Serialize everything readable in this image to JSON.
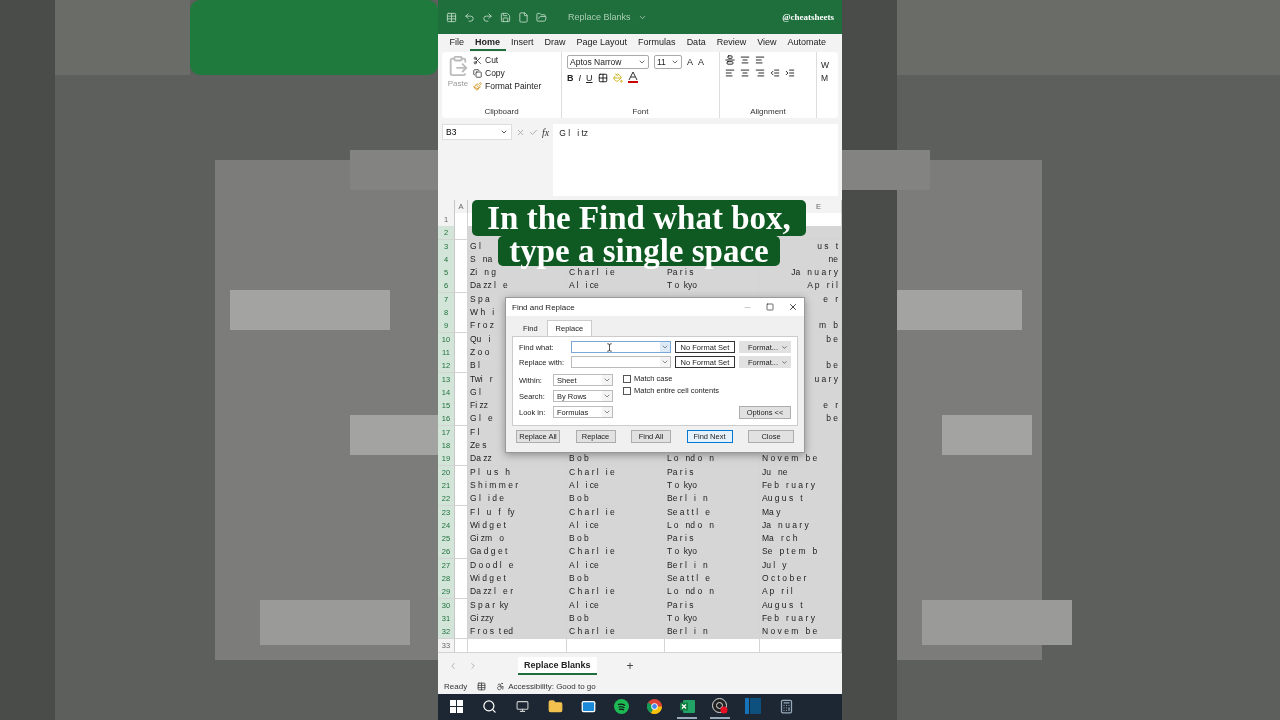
{
  "title_bar": {
    "file_name": "Replace Blanks",
    "handle": "@cheatsheets"
  },
  "ribbon_tabs": [
    {
      "label": "File",
      "selected": false
    },
    {
      "label": "Home",
      "selected": true
    },
    {
      "label": "Insert",
      "selected": false
    },
    {
      "label": "Draw",
      "selected": false
    },
    {
      "label": "Page Layout",
      "selected": false
    },
    {
      "label": "Formulas",
      "selected": false
    },
    {
      "label": "Data",
      "selected": false
    },
    {
      "label": "Review",
      "selected": false
    },
    {
      "label": "View",
      "selected": false
    },
    {
      "label": "Automate",
      "selected": false
    }
  ],
  "ribbon": {
    "clipboard": {
      "paste": "Paste",
      "cut": "Cut",
      "copy": "Copy",
      "format_painter": "Format Painter",
      "label": "Clipboard"
    },
    "font": {
      "name": "Aptos Narrow",
      "size": "11",
      "grow": "A",
      "shrink": "A",
      "bold": "B",
      "italic": "I",
      "underline": "U",
      "label": "Font"
    },
    "alignment": {
      "label": "Alignment"
    },
    "wrap_text": "W",
    "merge": "M"
  },
  "formula_bar": {
    "cell": "B3",
    "fx": "fx",
    "content": "G l   i tz"
  },
  "column_headers": [
    "A",
    "E"
  ],
  "rows": [
    {
      "number": "1",
      "selected": false
    },
    {
      "number": "2",
      "selected": true
    },
    {
      "number": "3",
      "selected": true,
      "b": "G l",
      "e": "u s   t"
    },
    {
      "number": "4",
      "selected": true,
      "b": "S   na",
      "e": "ne"
    },
    {
      "number": "5",
      "selected": true,
      "b": "Zi   n g",
      "c": "C h a r l   i e",
      "d": "Pa r i s",
      "e": "Ja   n u a r y"
    },
    {
      "number": "6",
      "selected": true,
      "b": "Da zz l   e",
      "c": "A l   i ce",
      "d": "T o  kyo",
      "e": "A p   r i l"
    },
    {
      "number": "7",
      "selected": true,
      "b": "S p a",
      "e": "e   r"
    },
    {
      "number": "8",
      "selected": true,
      "b": "W h   i"
    },
    {
      "number": "9",
      "selected": true,
      "b": "F r o z",
      "e": "m   b"
    },
    {
      "number": "10",
      "selected": true,
      "b": "Qu   i",
      "e": "b e"
    },
    {
      "number": "11",
      "selected": true,
      "b": "Z o o"
    },
    {
      "number": "12",
      "selected": true,
      "b": "B l",
      "e": "b e"
    },
    {
      "number": "13",
      "selected": true,
      "b": "Twi   r",
      "e": "u a r y"
    },
    {
      "number": "14",
      "selected": true,
      "b": "G l"
    },
    {
      "number": "15",
      "selected": true,
      "b": "Fi zz",
      "e": "e   r"
    },
    {
      "number": "16",
      "selected": true,
      "b": "G l   e",
      "e": "b e"
    },
    {
      "number": "17",
      "selected": true,
      "b": "F l"
    },
    {
      "number": "18",
      "selected": true,
      "b": "Ze s"
    },
    {
      "number": "19",
      "selected": true,
      "b": "Da zz",
      "c": "B o b",
      "d": "L o   nd o   n",
      "e": "N o v e m   b e"
    },
    {
      "number": "20",
      "selected": true,
      "b": "P l   u s   h",
      "c": "C h a r l   i e",
      "d": "Pa r i s",
      "e": "Ju   ne"
    },
    {
      "number": "21",
      "selected": true,
      "b": "S h i m m e r",
      "c": "A l   i ce",
      "d": "T o  kyo",
      "e": "Fe b   r u a r y"
    },
    {
      "number": "22",
      "selected": true,
      "b": "G l   i d e",
      "c": "B o b",
      "d": "Be r l   i   n",
      "e": "Au g u s   t"
    },
    {
      "number": "23",
      "selected": true,
      "b": "F l   u   f   fy",
      "c": "C h a r l   i e",
      "d": "Se a t t l   e",
      "e": "Ma y"
    },
    {
      "number": "24",
      "selected": true,
      "b": "Wi d g e t",
      "c": "A l   i ce",
      "d": "L o   nd o   n",
      "e": "Ja   n u a r y"
    },
    {
      "number": "25",
      "selected": true,
      "b": "Gi zm   o",
      "c": "B o b",
      "d": "Pa r i s",
      "e": "Ma   r c h"
    },
    {
      "number": "26",
      "selected": true,
      "b": "Ga d g e t",
      "c": "C h a r l   i e",
      "d": "T o  kyo",
      "e": "Se   p t e m   b"
    },
    {
      "number": "27",
      "selected": true,
      "b": "D o o d l   e",
      "c": "A l   i ce",
      "d": "Be r l   i   n",
      "e": "Ju l   y"
    },
    {
      "number": "28",
      "selected": true,
      "b": "Wi d g e t",
      "c": "B o b",
      "d": "Se a t t l   e",
      "e": "O c t o b e r"
    },
    {
      "number": "29",
      "selected": true,
      "b": "Da zz l   e r",
      "c": "C h a r l   i e",
      "d": "L o   nd o   n",
      "e": "A p   r i l"
    },
    {
      "number": "30",
      "selected": true,
      "b": "S p a r  ky",
      "c": "A l   i ce",
      "d": "Pa r i s",
      "e": "Au g u s   t"
    },
    {
      "number": "31",
      "selected": true,
      "b": "Gi zzy",
      "c": "B o b",
      "d": "T o  kyo",
      "e": "Fe b   r u a r y"
    },
    {
      "number": "32",
      "selected": true,
      "b": "F r o s  t ed",
      "c": "C h a r l   i e",
      "d": "Be r l   i   n",
      "e": "N o v e m   b e"
    },
    {
      "number": "33",
      "selected": false
    }
  ],
  "caption": [
    "In the Find what box,",
    "type a single space"
  ],
  "dialog": {
    "title": "Find and Replace",
    "tabs": [
      {
        "label": "Find",
        "selected": false
      },
      {
        "label": "Replace",
        "selected": true
      }
    ],
    "find_what": {
      "label": "Find what:",
      "format": "No Format Set",
      "format_button": "Format..."
    },
    "replace_with": {
      "label": "Replace with:",
      "format": "No Format Set",
      "format_button": "Format..."
    },
    "selects": [
      {
        "label": "Within:",
        "value": "Sheet"
      },
      {
        "label": "Search:",
        "value": "By Rows"
      },
      {
        "label": "Look in:",
        "value": "Formulas"
      }
    ],
    "checkboxes": [
      {
        "label": "Match case",
        "checked": false
      },
      {
        "label": "Match entire cell contents",
        "checked": false
      }
    ],
    "options_button": "Options <<",
    "buttons": [
      {
        "label": "Replace All",
        "selected": false
      },
      {
        "label": "Replace",
        "selected": false
      },
      {
        "label": "Find All",
        "selected": false
      },
      {
        "label": "Find Next",
        "selected": true
      },
      {
        "label": "Close",
        "selected": false
      }
    ]
  },
  "sheet_tabs": [
    {
      "label": "Replace Blanks",
      "selected": true
    }
  ],
  "add_sheet": "+",
  "status_bar": {
    "mode": "Ready",
    "accessibility": "Accessibility: Good to go"
  },
  "taskbar": [
    {
      "kind": "start",
      "active": false
    },
    {
      "kind": "search",
      "active": false
    },
    {
      "kind": "taskview",
      "active": false
    },
    {
      "kind": "files",
      "active": false
    },
    {
      "kind": "mail",
      "active": false
    },
    {
      "kind": "music",
      "active": false
    },
    {
      "kind": "browser",
      "active": false
    },
    {
      "kind": "excel",
      "active": true
    },
    {
      "kind": "recorder",
      "active": true
    },
    {
      "kind": "panel",
      "active": false
    },
    {
      "kind": "calculator",
      "active": false
    }
  ]
}
